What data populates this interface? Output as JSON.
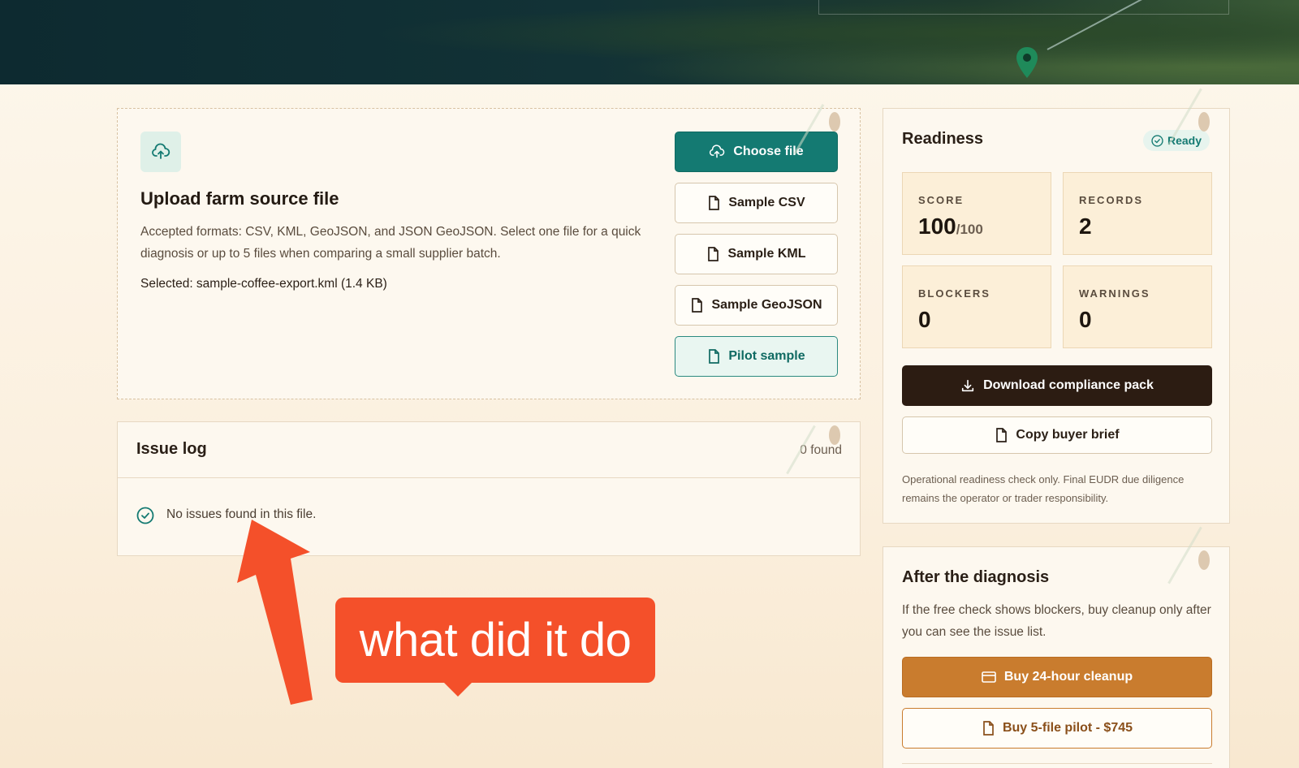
{
  "upload": {
    "title": "Upload farm source file",
    "description": "Accepted formats: CSV, KML, GeoJSON, and JSON GeoJSON. Select one file for a quick diagnosis or up to 5 files when comparing a small supplier batch.",
    "selected": "Selected: sample-coffee-export.kml (1.4 KB)",
    "icon": "upload-cloud-icon",
    "buttons": {
      "choose": "Choose file",
      "sample_csv": "Sample CSV",
      "sample_kml": "Sample KML",
      "sample_geojson": "Sample GeoJSON",
      "pilot": "Pilot sample"
    }
  },
  "issues": {
    "title": "Issue log",
    "count": "0 found",
    "empty_message": "No issues found in this file."
  },
  "readiness": {
    "title": "Readiness",
    "badge": "Ready",
    "stats": {
      "score_label": "SCORE",
      "score_value": "100",
      "score_max": "/100",
      "records_label": "RECORDS",
      "records_value": "2",
      "blockers_label": "BLOCKERS",
      "blockers_value": "0",
      "warnings_label": "WARNINGS",
      "warnings_value": "0"
    },
    "download_label": "Download compliance pack",
    "copy_label": "Copy buyer brief",
    "note": "Operational readiness check only. Final EUDR due diligence remains the operator or trader responsibility."
  },
  "after": {
    "title": "After the diagnosis",
    "description": "If the free check shows blockers, buy cleanup only after you can see the issue list.",
    "cleanup_label": "Buy 24-hour cleanup",
    "pilot_label": "Buy 5-file pilot - $745"
  },
  "annotation": {
    "text": "what did it do"
  },
  "colors": {
    "accent": "#147a72",
    "dark": "#2c1c12",
    "amber": "#c97c2e",
    "callout": "#f4502a"
  }
}
